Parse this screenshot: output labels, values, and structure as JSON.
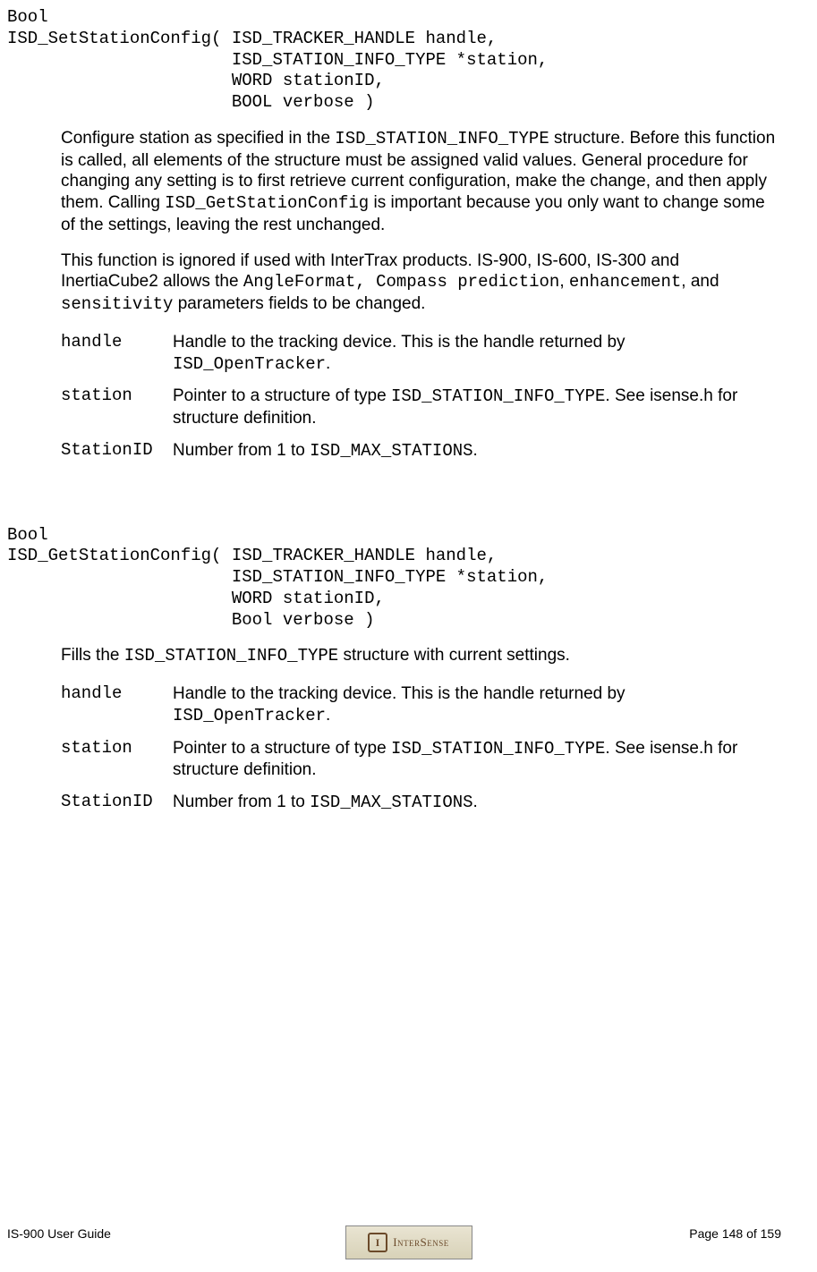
{
  "func1": {
    "signature": "Bool\nISD_SetStationConfig( ISD_TRACKER_HANDLE handle,\n                      ISD_STATION_INFO_TYPE *station,\n                      WORD stationID,\n                      BOOL verbose )",
    "para1_a": "Configure station as specified in the ",
    "para1_code1": "ISD_STATION_INFO_TYPE",
    "para1_b": " structure. Before this function is called, all elements of the structure must be assigned valid values. General procedure for changing any setting is to first retrieve current configuration, make the change, and then apply them.  Calling ",
    "para1_code2": "ISD_GetStationConfig",
    "para1_c": " is important because you only want to change some of the settings, leaving the rest unchanged.",
    "para2_a": "This function is ignored if used with InterTrax products.  IS-900, IS-600, IS-300 and InertiaCube2 allows the ",
    "para2_code1": "AngleFormat, Compass prediction",
    "para2_b": ", ",
    "para2_code2": "enhancement",
    "para2_c": ", and ",
    "para2_code3": "sensitivity",
    "para2_d": " parameters  fields to be changed.",
    "params": {
      "handle": {
        "name": "handle",
        "desc_a": "Handle to the tracking device.  This is the handle returned by ",
        "desc_code": "ISD_OpenTracker",
        "desc_b": "."
      },
      "station": {
        "name": "station",
        "desc_a": "Pointer to a structure of type ",
        "desc_code": "ISD_STATION_INFO_TYPE",
        "desc_b": ".  See isense.h for structure definition."
      },
      "stationID": {
        "name": "StationID",
        "desc_a": "Number from 1 to ",
        "desc_code": "ISD_MAX_STATIONS",
        "desc_b": "."
      }
    }
  },
  "func2": {
    "signature": "Bool\nISD_GetStationConfig( ISD_TRACKER_HANDLE handle,\n                      ISD_STATION_INFO_TYPE *station,\n                      WORD stationID,\n                      Bool verbose )",
    "para1_a": "Fills the ",
    "para1_code1": "ISD_STATION_INFO_TYPE",
    "para1_b": " structure with current settings.",
    "params": {
      "handle": {
        "name": "handle",
        "desc_a": "Handle to the tracking device.  This is the handle returned by ",
        "desc_code": "ISD_OpenTracker",
        "desc_b": "."
      },
      "station": {
        "name": "station",
        "desc_a": "Pointer to a structure of type ",
        "desc_code": "ISD_STATION_INFO_TYPE",
        "desc_b": ".  See isense.h for structure definition."
      },
      "stationID": {
        "name": "StationID",
        "desc_a": "Number from 1 to ",
        "desc_code": "ISD_MAX_STATIONS",
        "desc_b": "."
      }
    }
  },
  "footer": {
    "left": "IS-900 User Guide",
    "right": "Page 148 of 159",
    "logo": "InterSense"
  }
}
